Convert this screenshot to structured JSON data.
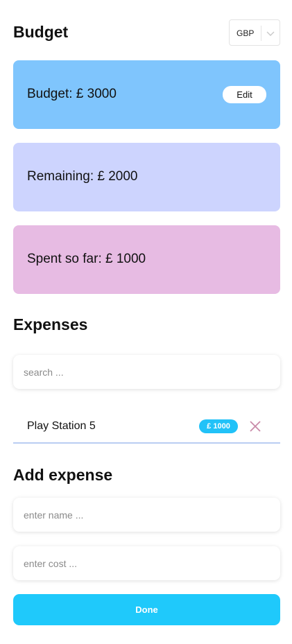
{
  "header": {
    "title": "Budget",
    "currency": {
      "selected": "GBP",
      "icon": "chevron-down-icon"
    }
  },
  "cards": {
    "budget": {
      "text": "Budget: £ 3000",
      "edit_label": "Edit",
      "color": "#7fc5fd"
    },
    "remaining": {
      "text": "Remaining: £ 2000",
      "color": "#cdd4fe"
    },
    "spent": {
      "text": "Spent so far: £ 1000",
      "color": "#e7bbe3"
    }
  },
  "expenses": {
    "title": "Expenses",
    "search_placeholder": "search ...",
    "items": [
      {
        "name": "Play Station 5",
        "cost": "£ 1000",
        "delete_icon": "close-icon"
      }
    ]
  },
  "add_expense": {
    "title": "Add expense",
    "name_placeholder": "enter name ...",
    "cost_placeholder": "enter cost ...",
    "done_label": "Done"
  },
  "colors": {
    "accent": "#1fc9fb",
    "badge": "#21c2f8",
    "delete_icon": "#c98aa8",
    "row_divider": "#b9cdf2"
  }
}
